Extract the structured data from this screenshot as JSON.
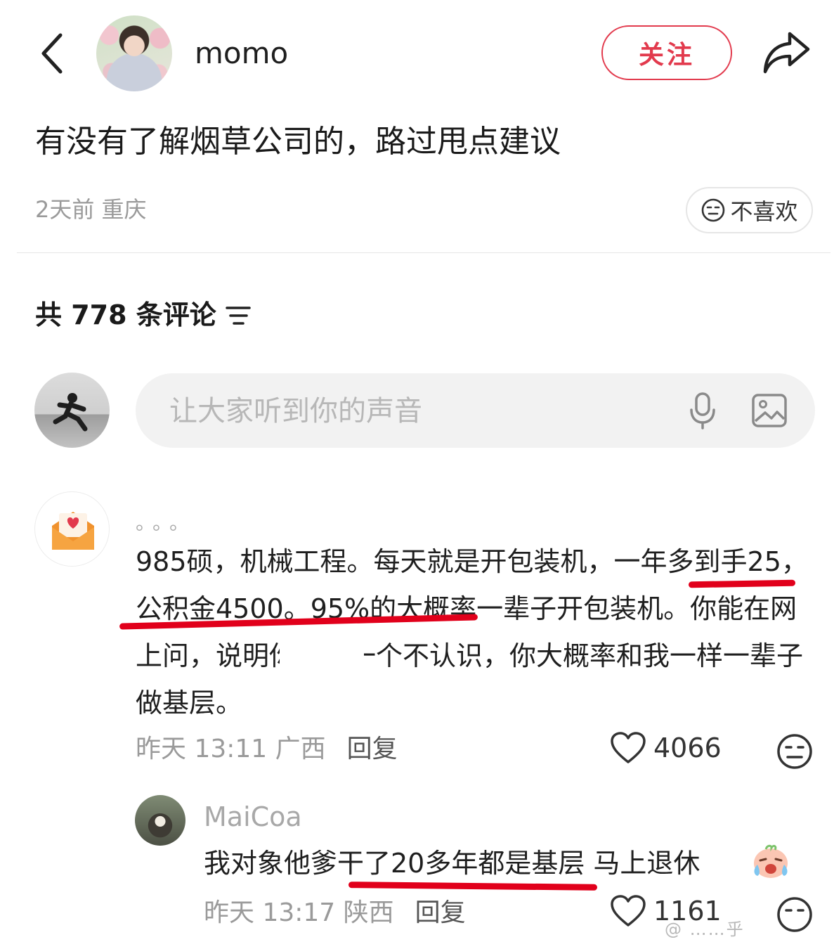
{
  "header": {
    "author_name": "momo",
    "follow_label": "关注"
  },
  "post": {
    "title": "有没有了解烟草公司的，路过甩点建议",
    "meta": "2天前 重庆",
    "dislike_label": "不喜欢"
  },
  "comments_section": {
    "count_label": "共 778 条评论"
  },
  "input": {
    "placeholder": "让大家听到你的声音"
  },
  "comments": [
    {
      "username": "。。。",
      "text": "985硕，机械工程。每天就是开包装机，一年多到手25，公积金4500。95%的大概率一辈子开包装机。你能在网上问，说明你里面一个不认识，你大概率和我一样一辈子做基层。",
      "time_location": "昨天 13:11 广西",
      "reply_label": "回复",
      "likes": "4066"
    }
  ],
  "replies": [
    {
      "username": "MaiCoa",
      "text": "我对象他爹干了20多年都是基层 马上退休",
      "time_location": "昨天 13:17 陕西",
      "reply_label": "回复",
      "likes": "1161"
    }
  ],
  "watermark": "@ ……乎",
  "colors": {
    "accent": "#e23a4d",
    "annotation": "#e1001b"
  }
}
